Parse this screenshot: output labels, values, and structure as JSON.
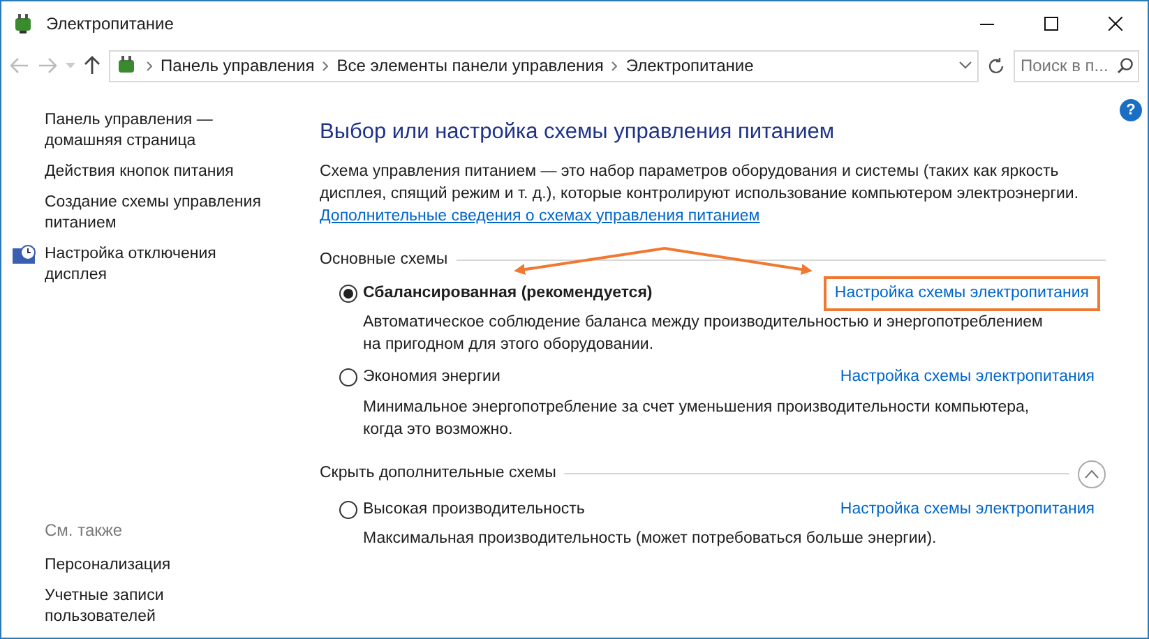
{
  "window": {
    "title": "Электропитание"
  },
  "address_bar": {
    "breadcrumbs": [
      "Панель управления",
      "Все элементы панели управления",
      "Электропитание"
    ]
  },
  "search": {
    "placeholder": "Поиск в п..."
  },
  "help": {
    "label": "?"
  },
  "sidebar": {
    "items": [
      {
        "label": "Панель управления — домашняя страница",
        "kind": "link"
      },
      {
        "label": "Действия кнопок питания",
        "kind": "link"
      },
      {
        "label": "Создание схемы управления питанием",
        "kind": "link"
      },
      {
        "label": "Настройка отключения дисплея",
        "kind": "iconlink"
      }
    ],
    "see_also": {
      "title": "См. также",
      "items": [
        "Персонализация",
        "Учетные записи пользователей"
      ]
    }
  },
  "main": {
    "heading": "Выбор или настройка схемы управления питанием",
    "description": "Схема управления питанием — это набор параметров оборудования и системы (таких как яркость дисплея, спящий режим и т. д.), которые контролируют использование компьютером электроэнергии.",
    "more_link": "Дополнительные сведения о схемах управления питанием",
    "groups": [
      {
        "title": "Основные схемы",
        "kind": "plain",
        "schemes": [
          {
            "name": "Сбалансированная (рекомендуется)",
            "selected": true,
            "description": "Автоматическое соблюдение баланса между производительностью и энергопотреблением на пригодном для этого оборудовании.",
            "link": "Настройка схемы электропитания",
            "highlighted": true
          },
          {
            "name": "Экономия энергии",
            "selected": false,
            "description": "Минимальное энергопотребление за счет уменьшения производительности компьютера, когда это возможно.",
            "link": "Настройка схемы электропитания",
            "highlighted": false
          }
        ]
      },
      {
        "title": "Скрыть дополнительные схемы",
        "kind": "collapsible",
        "expanded": true,
        "schemes": [
          {
            "name": "Высокая производительность",
            "selected": false,
            "description": "Максимальная производительность (может потребоваться больше энергии).",
            "link": "Настройка схемы электропитания",
            "highlighted": false
          }
        ]
      }
    ]
  }
}
